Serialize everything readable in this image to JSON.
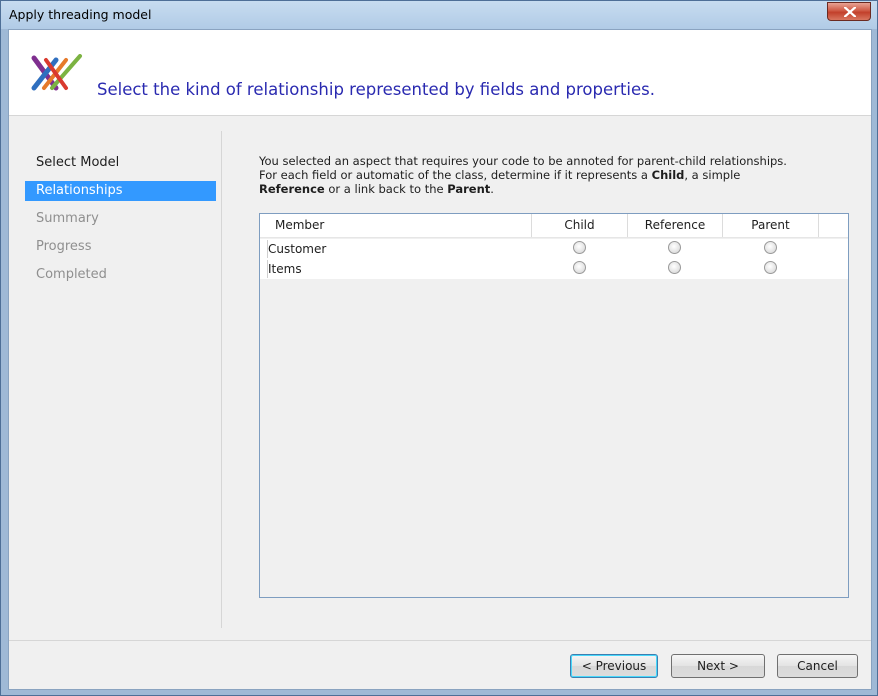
{
  "window": {
    "title": "Apply threading model"
  },
  "header": {
    "title": "Select the kind of relationship represented by fields and properties.",
    "accent_color": "#2a2ab0"
  },
  "sidebar": {
    "items": [
      {
        "label": "Select Model",
        "state": "done"
      },
      {
        "label": "Relationships",
        "state": "active"
      },
      {
        "label": "Summary",
        "state": "pending"
      },
      {
        "label": "Progress",
        "state": "pending"
      },
      {
        "label": "Completed",
        "state": "pending"
      }
    ]
  },
  "description": {
    "line1": "You selected an aspect that requires your code to be annoted for parent-child relationships.",
    "line2_pre": "For each field or automatic of the class, determine if it represents a ",
    "line2_bold": "Child",
    "line2_post": ", a simple",
    "line3_bold1": "Reference",
    "line3_mid": " or a link back to the ",
    "line3_bold2": "Parent",
    "line3_end": "."
  },
  "grid": {
    "columns": [
      "Member",
      "Child",
      "Reference",
      "Parent"
    ],
    "rows": [
      {
        "member": "Customer",
        "selected": null
      },
      {
        "member": "Items",
        "selected": null
      }
    ]
  },
  "footer": {
    "previous_label": "< Previous",
    "next_label": "Next >",
    "cancel_label": "Cancel"
  },
  "icons": {
    "close": "close-icon",
    "logo": "app-logo-icon"
  },
  "colors": {
    "selection": "#3399ff",
    "grid_border": "#7e9dc0",
    "close_button": "#c2402b"
  }
}
